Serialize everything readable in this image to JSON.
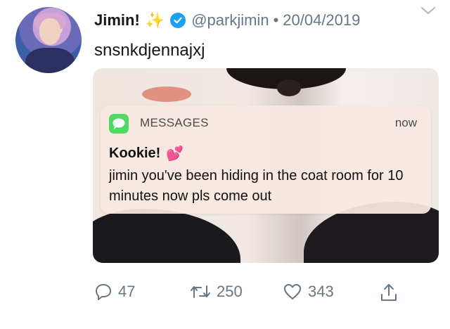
{
  "tweet": {
    "display_name": "Jimin!",
    "handle": "@parkjimin",
    "separator": "•",
    "date": "20/04/2019",
    "text": "snsnkdjennajxj"
  },
  "notification": {
    "app_name": "MESSAGES",
    "time": "now",
    "sender": "Kookie!",
    "body": "jimin you've been hiding in the coat room for 10 minutes now pls come out"
  },
  "actions": {
    "replies": "47",
    "retweets": "250",
    "likes": "343"
  },
  "colors": {
    "verified": "#1da1f2",
    "secondary_text": "#657786",
    "messages_green": "#4cd964"
  },
  "icons": [
    "sparkles-icon",
    "verified-badge-icon",
    "chevron-down-icon",
    "messages-app-icon",
    "two-hearts-icon",
    "reply-icon",
    "retweet-icon",
    "like-icon",
    "share-icon"
  ]
}
